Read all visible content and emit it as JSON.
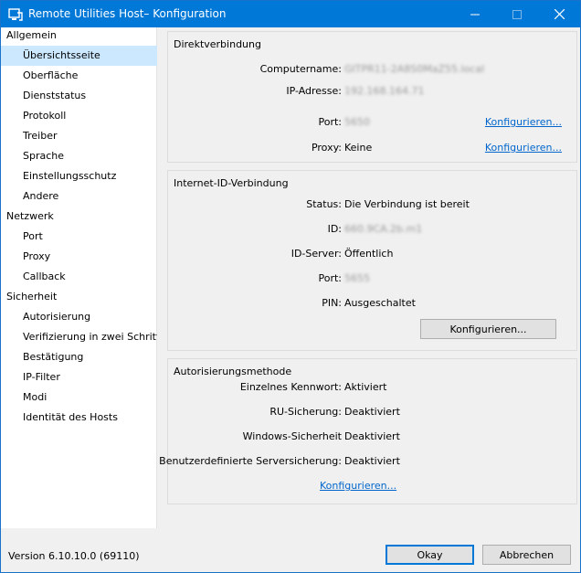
{
  "window": {
    "title": "Remote Utilities Host– Konfiguration",
    "icon": "remote-utilities-icon",
    "accent": "#0078d7"
  },
  "sidebar": {
    "items": [
      {
        "label": "Allgemein",
        "type": "group"
      },
      {
        "label": "Übersichtsseite",
        "type": "child",
        "selected": true
      },
      {
        "label": "Oberfläche",
        "type": "child"
      },
      {
        "label": "Dienststatus",
        "type": "child"
      },
      {
        "label": "Protokoll",
        "type": "child"
      },
      {
        "label": "Treiber",
        "type": "child"
      },
      {
        "label": "Sprache",
        "type": "child"
      },
      {
        "label": "Einstellungsschutz",
        "type": "child"
      },
      {
        "label": "Andere",
        "type": "child"
      },
      {
        "label": "Netzwerk",
        "type": "group"
      },
      {
        "label": "Port",
        "type": "child"
      },
      {
        "label": "Proxy",
        "type": "child"
      },
      {
        "label": "Callback",
        "type": "child"
      },
      {
        "label": "Sicherheit",
        "type": "group"
      },
      {
        "label": "Autorisierung",
        "type": "child"
      },
      {
        "label": "Verifizierung in zwei Schritten",
        "type": "child"
      },
      {
        "label": "Bestätigung",
        "type": "child"
      },
      {
        "label": "IP-Filter",
        "type": "child"
      },
      {
        "label": "Modi",
        "type": "child"
      },
      {
        "label": "Identität des Hosts",
        "type": "child"
      }
    ]
  },
  "direct": {
    "title": "Direktverbindung",
    "computername_label": "Computername:",
    "computername_value": "GITPR11-2A8S0MaZ55.local",
    "ip_label": "IP-Adresse:",
    "ip_value": "192.168.164.71",
    "port_label": "Port:",
    "port_value": "5650",
    "proxy_label": "Proxy:",
    "proxy_value": "Keine",
    "configure_port": "Konfigurieren...",
    "configure_proxy": "Konfigurieren..."
  },
  "internet_id": {
    "title": "Internet-ID-Verbindung",
    "status_label": "Status:",
    "status_value": "Die Verbindung ist bereit",
    "id_label": "ID:",
    "id_value": "660.9CA.2b.m1",
    "server_label": "ID-Server:",
    "server_value": "Öffentlich",
    "port_label": "Port:",
    "port_value": "5655",
    "pin_label": "PIN:",
    "pin_value": "Ausgeschaltet",
    "configure_button": "Konfigurieren..."
  },
  "auth": {
    "title": "Autorisierungsmethode",
    "single_password_label": "Einzelnes Kennwort:",
    "single_password_value": "Aktiviert",
    "ru_label": "RU-Sicherung:",
    "ru_value": "Deaktiviert",
    "windows_label": "Windows-Sicherheit",
    "windows_value": "Deaktiviert",
    "custom_label": "Benutzerdefinierte Serversicherung:",
    "custom_value": "Deaktiviert",
    "configure_link": "Konfigurieren..."
  },
  "footer": {
    "version": "Version 6.10.10.0 (69110)",
    "ok_label": "Okay",
    "cancel_label": "Abbrechen"
  }
}
